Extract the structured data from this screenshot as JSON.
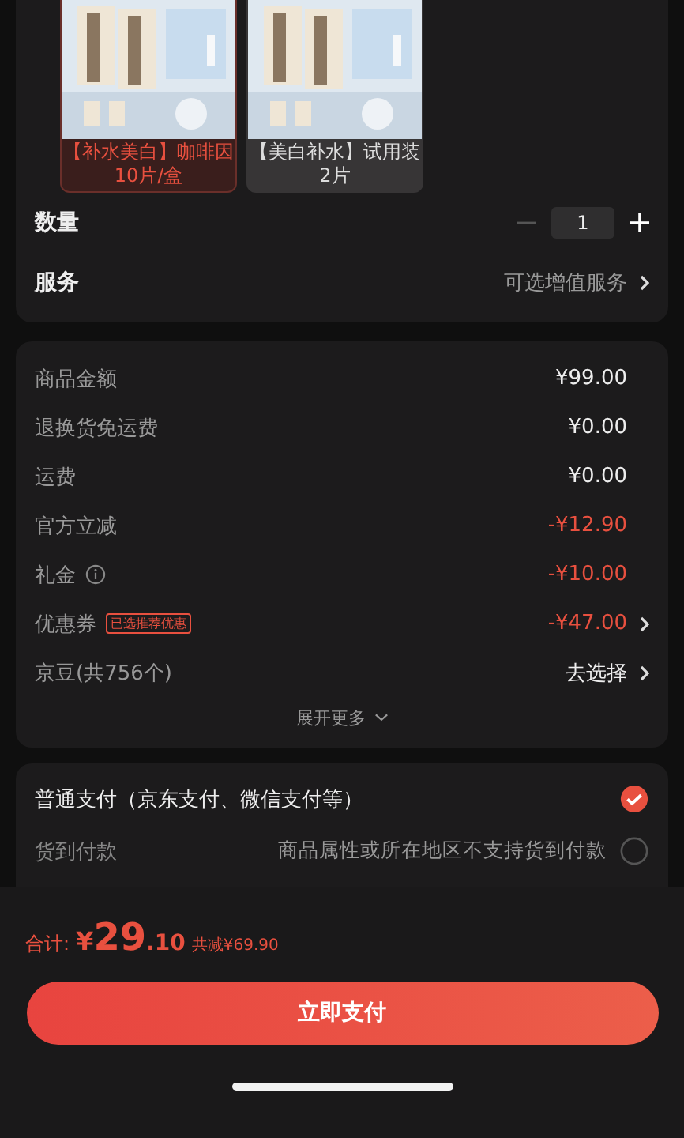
{
  "variants": [
    {
      "label": "【补水美白】咖啡因10片/盒",
      "selected": true
    },
    {
      "label": "【美白补水】试用装2片",
      "selected": false
    }
  ],
  "quantity": {
    "label": "数量",
    "value": "1",
    "decrement_disabled": true
  },
  "service": {
    "label": "服务",
    "value": "可选增值服务"
  },
  "price_rows": [
    {
      "label": "商品金额",
      "amount": "¥99.00",
      "kind": "plain"
    },
    {
      "label": "退换货免运费",
      "amount": "¥0.00",
      "kind": "plain"
    },
    {
      "label": "运费",
      "amount": "¥0.00",
      "kind": "plain"
    },
    {
      "label": "官方立减",
      "amount": "-¥12.90",
      "kind": "discount"
    },
    {
      "label": "礼金",
      "info": true,
      "amount": "-¥10.00",
      "kind": "discount"
    },
    {
      "label": "优惠券",
      "tag": "已选推荐优惠",
      "amount": "-¥47.00",
      "kind": "discount",
      "arrow": true
    },
    {
      "label": "京豆(共756个)",
      "amount": "去选择",
      "kind": "action",
      "arrow": true
    }
  ],
  "expand_more": "展开更多",
  "payment_options": [
    {
      "label": "普通支付（京东支付、微信支付等）",
      "selected": true,
      "disabled": false
    },
    {
      "label": "货到付款",
      "note": "商品属性或所在地区不支持货到付款",
      "selected": false,
      "disabled": true
    }
  ],
  "footer": {
    "total_label": "合计:",
    "currency": "¥",
    "total_integer": "29",
    "total_decimal": ".10",
    "saved": "共减¥69.90",
    "pay_button": "立即支付"
  }
}
